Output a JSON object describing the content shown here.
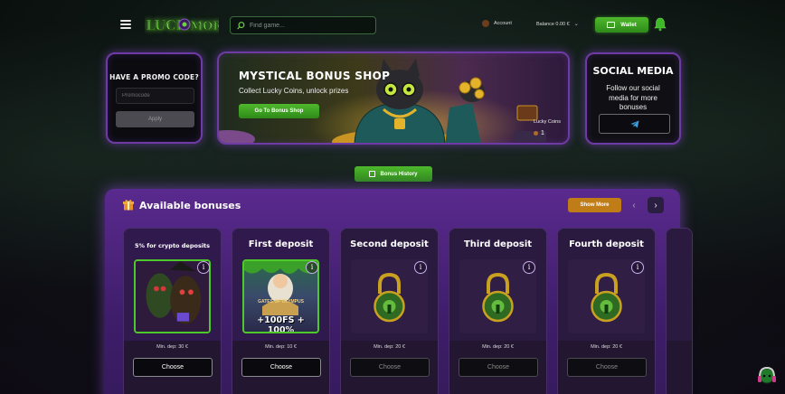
{
  "header": {
    "logo": "LUCK MORE",
    "search_placeholder": "Find game...",
    "account_label": "Account",
    "balance_label": "Balance 0.00 €",
    "wallet_label": "Wallet"
  },
  "promo": {
    "title": "HAVE A PROMO CODE?",
    "input_placeholder": "Promocode",
    "apply_label": "Apply"
  },
  "shop": {
    "title": "MYSTICAL BONUS SHOP",
    "subtitle": "Collect Lucky Coins, unlock prizes",
    "button_label": "Go To Bonus Shop",
    "coins_label": "Lucky Coins",
    "coins_value": "1"
  },
  "social": {
    "title": "SOCIAL MEDIA",
    "text": "Follow our social media for more bonuses",
    "icon": "telegram-icon"
  },
  "history_button": "Bonus History",
  "bonuses": {
    "title": "Available bonuses",
    "show_more": "Show More",
    "cards": [
      {
        "name": "5% for crypto deposits",
        "min_dep": "Min. dep: 30 €",
        "choose": "Choose",
        "active": true
      },
      {
        "name": "First deposit",
        "min_dep": "Min. dep: 10 €",
        "choose": "Choose",
        "active": true,
        "art_text_1": "GATES OF OLYMPUS",
        "art_text_2": "+100FS + 100%"
      },
      {
        "name": "Second deposit",
        "min_dep": "Min. dep: 20 €",
        "choose": "Choose",
        "active": false
      },
      {
        "name": "Third deposit",
        "min_dep": "Min. dep: 20 €",
        "choose": "Choose",
        "active": false
      },
      {
        "name": "Fourth deposit",
        "min_dep": "Min. dep: 20 €",
        "choose": "Choose",
        "active": false
      }
    ]
  },
  "colors": {
    "accent_green": "#3fa322",
    "panel_purple": "#6e3aa3",
    "show_more_orange": "#c07c16"
  }
}
